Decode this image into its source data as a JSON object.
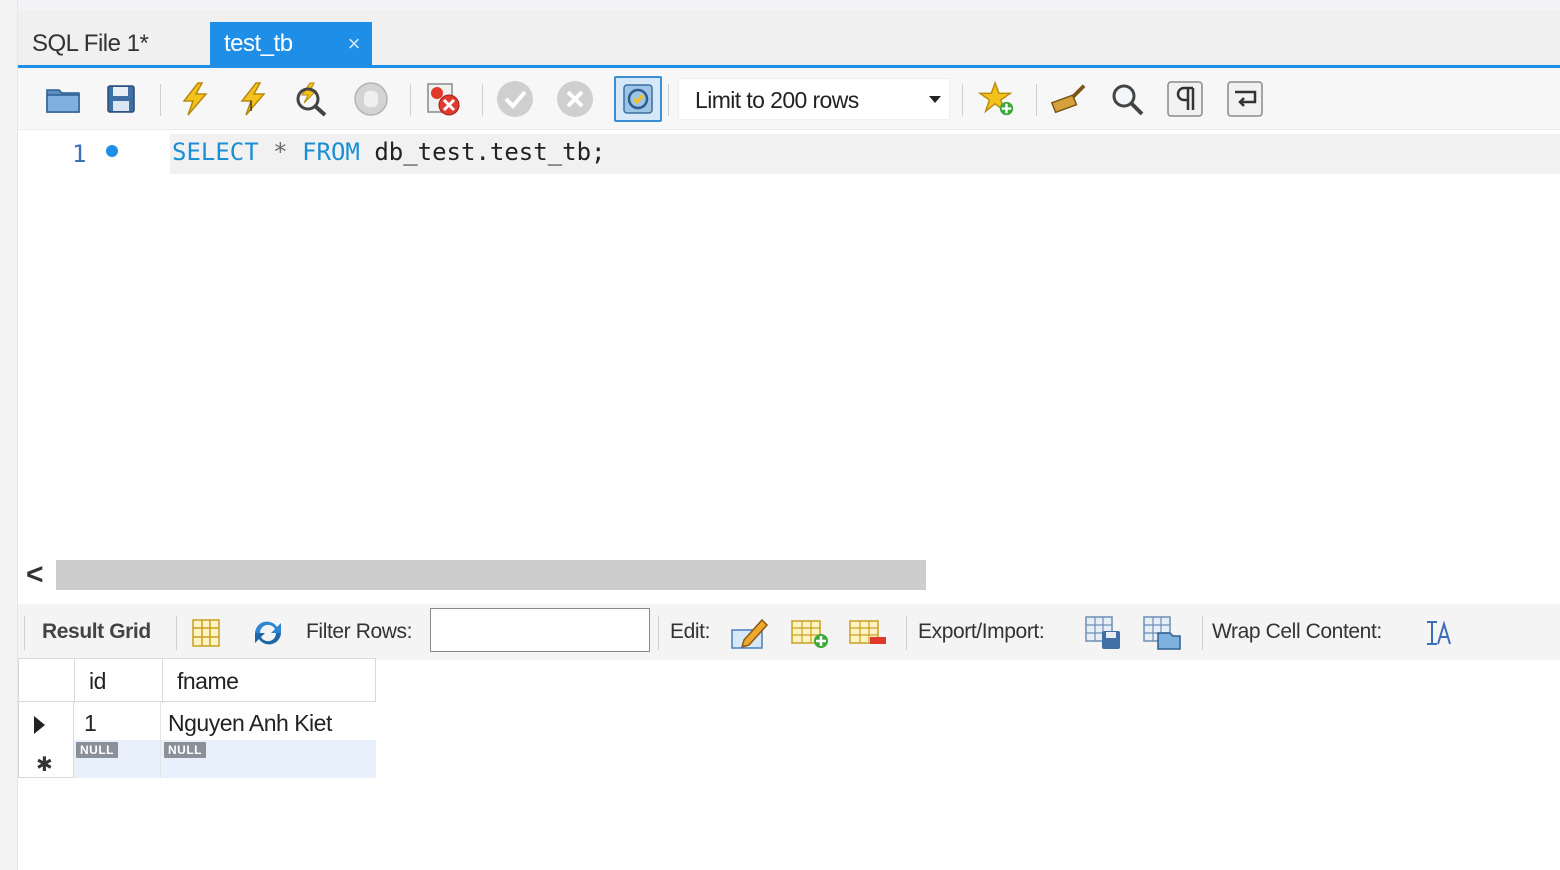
{
  "tabs": [
    {
      "label": "SQL File 1*",
      "active": false
    },
    {
      "label": "test_tb",
      "active": true,
      "close_glyph": "×"
    }
  ],
  "toolbar": {
    "icons": [
      "open-folder-icon",
      "save-icon",
      "execute-lightning-icon",
      "execute-current-lightning-icon",
      "explain-magnifier-icon",
      "stop-hand-icon",
      "stop-on-error-icon",
      "commit-check-icon",
      "rollback-x-icon",
      "autocommit-toggle-icon",
      "add-snippet-star-icon",
      "beautify-broom-icon",
      "find-icon",
      "invisible-chars-pilcrow-icon",
      "word-wrap-icon"
    ],
    "limit_label": "Limit to 200 rows"
  },
  "editor": {
    "line_number": "1",
    "code_tokens": {
      "kw1": "SELECT",
      "star": "*",
      "kw2": "FROM",
      "ident": "db_test.test_tb;"
    }
  },
  "scrollbar": {
    "left_glyph": "<"
  },
  "result_toolbar": {
    "result_grid_label": "Result Grid",
    "filter_label": "Filter Rows:",
    "filter_value": "",
    "edit_label": "Edit:",
    "export_label": "Export/Import:",
    "wrap_label": "Wrap Cell Content:"
  },
  "grid": {
    "columns": [
      "id",
      "fname"
    ],
    "rows": [
      {
        "id": "1",
        "fname": "Nguyen Anh Kiet"
      }
    ],
    "new_row": {
      "id": "NULL",
      "fname": "NULL"
    },
    "new_row_marker": "✱"
  },
  "colors": {
    "accent": "#1e8ee6",
    "keyword": "#1a8fd6",
    "null_badge": "#8a8f98"
  }
}
